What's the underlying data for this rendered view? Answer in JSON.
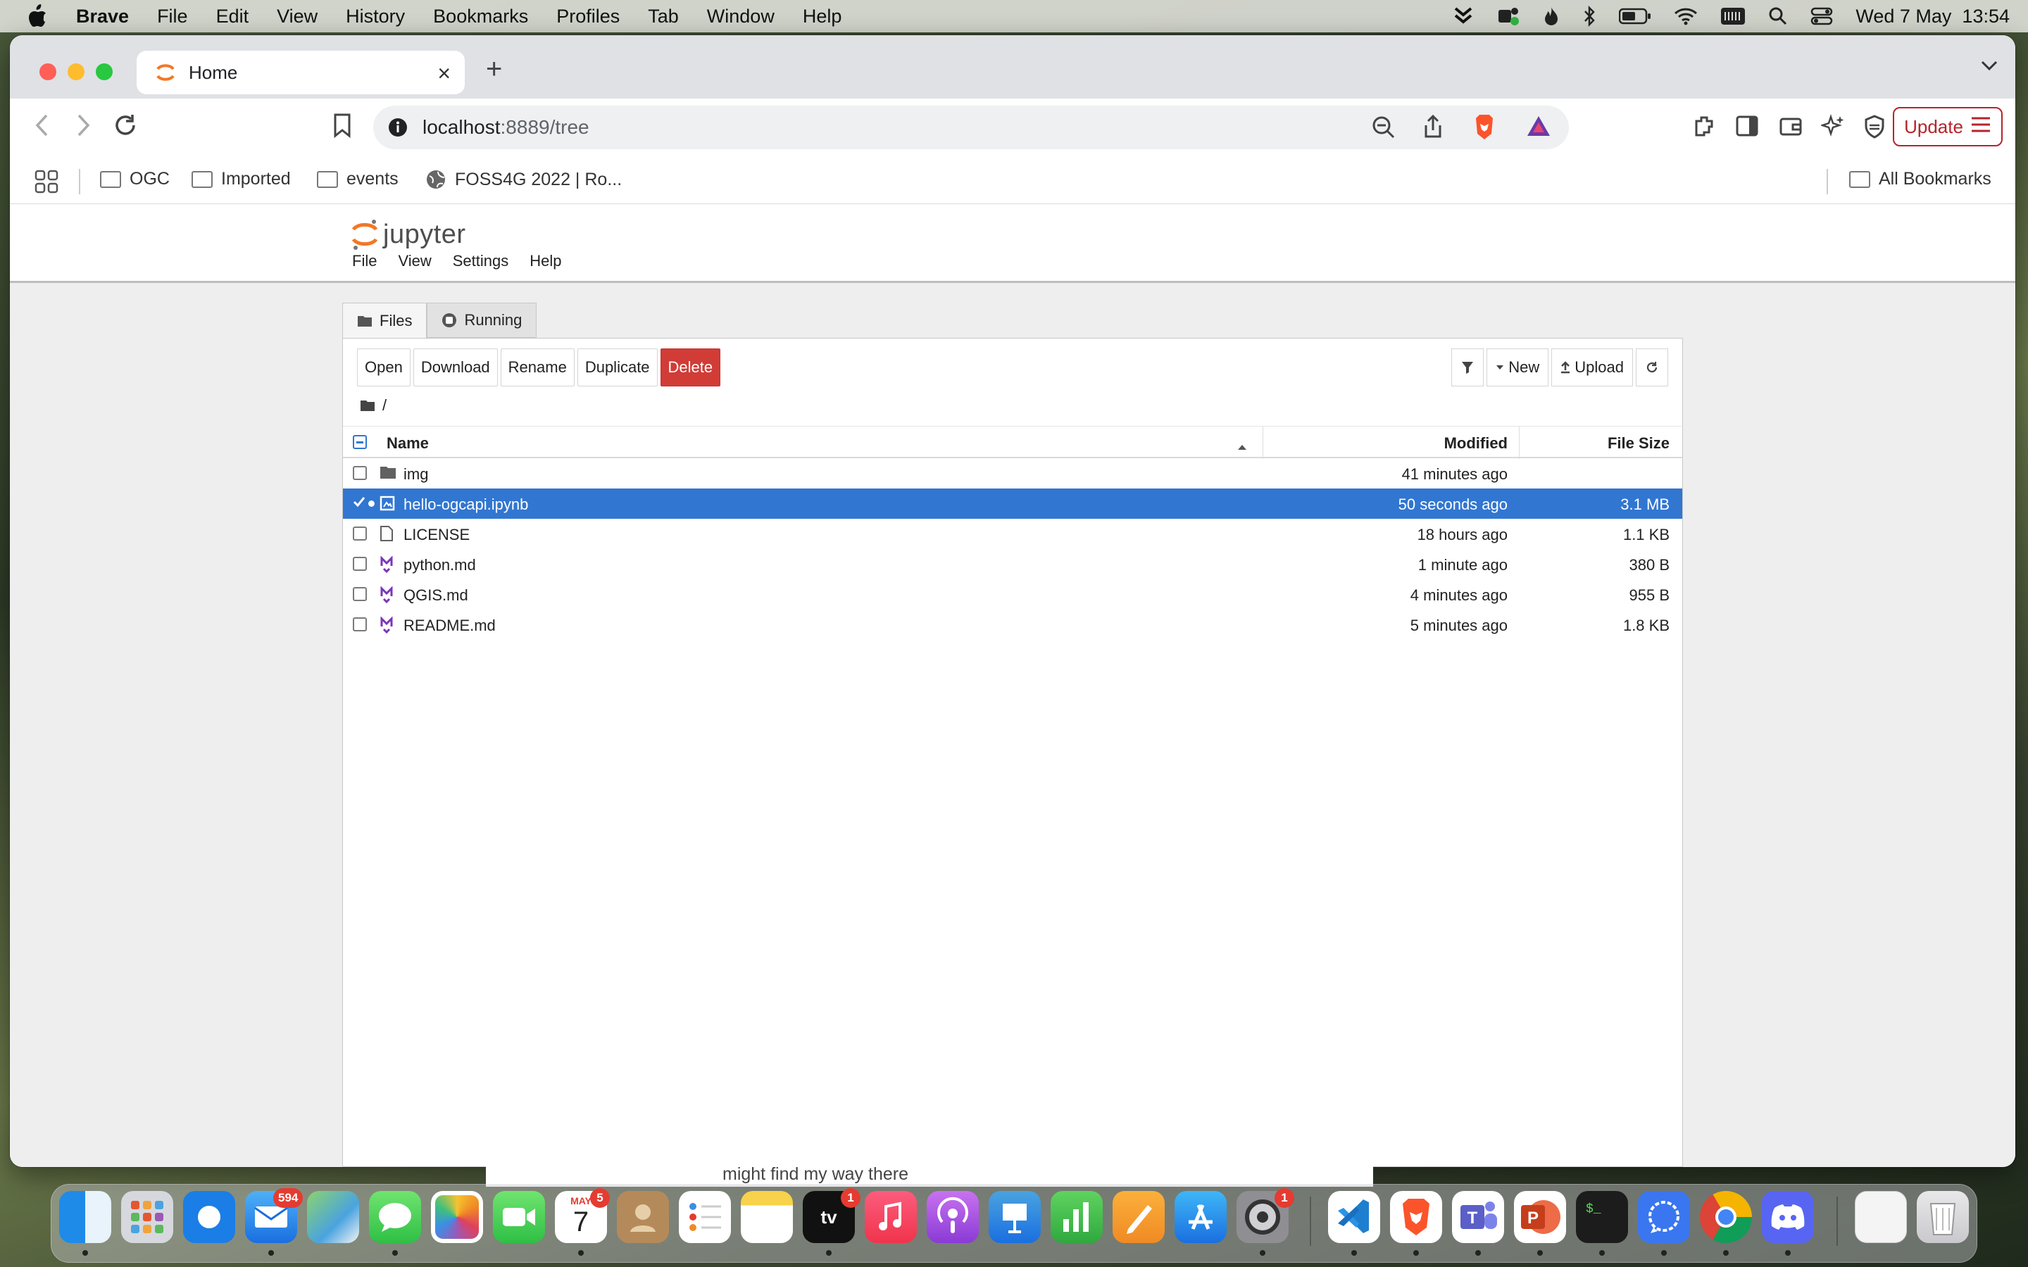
{
  "menubar": {
    "app": "Brave",
    "items": [
      "File",
      "Edit",
      "View",
      "History",
      "Bookmarks",
      "Profiles",
      "Tab",
      "Window",
      "Help"
    ],
    "clock": "Wed 7 May  13:54"
  },
  "browser": {
    "tab_title": "Home",
    "url_host": "localhost",
    "url_rest": ":8889/tree",
    "update_label": "Update",
    "bookmarks": [
      "OGC",
      "Imported",
      "events",
      "FOSS4G 2022 | Ro..."
    ],
    "all_bookmarks": "All Bookmarks"
  },
  "jupyter": {
    "logo_text": "jupyter",
    "menu": [
      "File",
      "View",
      "Settings",
      "Help"
    ],
    "tabs": [
      "Files",
      "Running"
    ],
    "actions": [
      "Open",
      "Download",
      "Rename",
      "Duplicate",
      "Delete"
    ],
    "new_label": "New",
    "upload_label": "Upload",
    "breadcrumb": "/",
    "columns": {
      "name": "Name",
      "modified": "Modified",
      "size": "File Size"
    },
    "files": [
      {
        "name": "img",
        "type": "folder",
        "modified": "41 minutes ago",
        "size": "",
        "selected": false
      },
      {
        "name": "hello-ogcapi.ipynb",
        "type": "notebook",
        "modified": "50 seconds ago",
        "size": "3.1 MB",
        "selected": true
      },
      {
        "name": "LICENSE",
        "type": "file",
        "modified": "18 hours ago",
        "size": "1.1 KB",
        "selected": false
      },
      {
        "name": "python.md",
        "type": "markdown",
        "modified": "1 minute ago",
        "size": "380 B",
        "selected": false
      },
      {
        "name": "QGIS.md",
        "type": "markdown",
        "modified": "4 minutes ago",
        "size": "955 B",
        "selected": false
      },
      {
        "name": "README.md",
        "type": "markdown",
        "modified": "5 minutes ago",
        "size": "1.8 KB",
        "selected": false
      }
    ]
  },
  "background_snippet": "might find my way there",
  "dock": {
    "badges": {
      "mail": "594",
      "calendar": "5",
      "tv": "1",
      "settings": "1"
    },
    "calendar": {
      "month": "MAY",
      "day": "7"
    }
  }
}
